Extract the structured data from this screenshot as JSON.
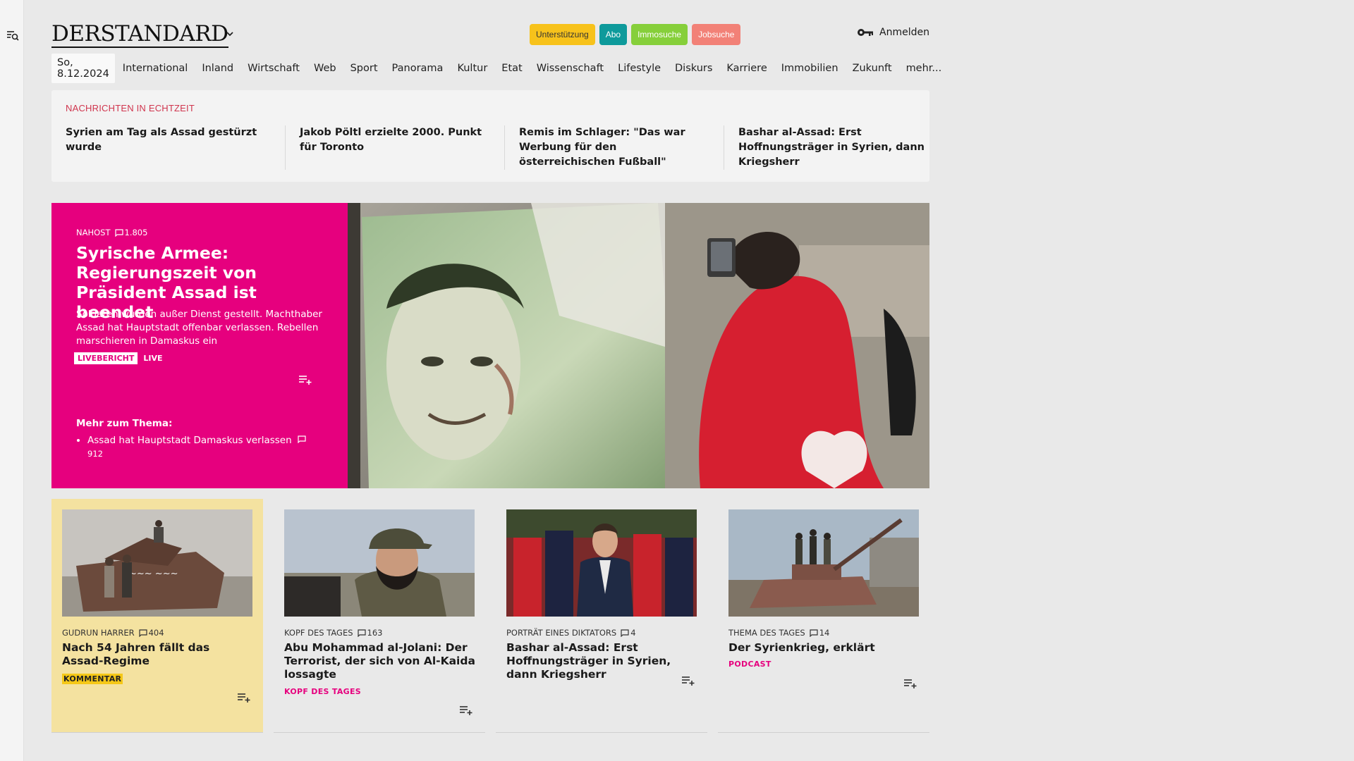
{
  "colors": {
    "accent_pink": "#e6007e",
    "ticker_red": "#d0354e",
    "card_yellow": "#f4e2a0"
  },
  "header": {
    "logo": "DERSTANDARD",
    "pills": [
      {
        "label": "Unterstützung",
        "bg": "#f7c21b",
        "fg": "#333333"
      },
      {
        "label": "Abo",
        "bg": "#0e9a9b",
        "fg": "#ffffff"
      },
      {
        "label": "Immosuche",
        "bg": "#86cf3a",
        "fg": "#ffffff"
      },
      {
        "label": "Jobsuche",
        "bg": "#f28177",
        "fg": "#ffffff"
      }
    ],
    "login_label": "Anmelden"
  },
  "nav": {
    "date": "So, 8.12.2024",
    "items": [
      "International",
      "Inland",
      "Wirtschaft",
      "Web",
      "Sport",
      "Panorama",
      "Kultur",
      "Etat",
      "Wissenschaft",
      "Lifestyle",
      "Diskurs",
      "Karriere",
      "Immobilien",
      "Zukunft",
      "mehr..."
    ]
  },
  "ticker": {
    "label": "NACHRICHTEN IN ECHTZEIT",
    "items": [
      "Syrien am Tag als Assad gestürzt wurde",
      "Jakob Pöltl erzielte 2000. Punkt für Toronto",
      "Remis im Schlager: \"Das war Wer­bung für den österreichischen Fußball\"",
      "Bashar al-Assad: Erst Hoffnungsträ­ger in Syrien, dann Kriegsherr"
    ]
  },
  "hero": {
    "kicker": "NAHOST",
    "comments": "1.805",
    "title": "Syrische Armee: Regierungszeit von Präsident Assad ist beendet",
    "lead": "Soldaten wurden außer Dienst gestellt. Machthaber Assad hat Hauptstadt offenbar verlassen. Rebellen marschieren in Damaskus ein",
    "tag_box": "LIVEBERICHT",
    "tag_live": "LIVE",
    "more_title": "Mehr zum Thema:",
    "more_items": [
      {
        "text": "Assad hat Hauptstadt Damaskus verlassen",
        "comments": "912"
      }
    ]
  },
  "cards": [
    {
      "kicker": "GUDRUN HARRER",
      "comments": "404",
      "title": "Nach 54 Jahren fällt das Assad-Regime",
      "tag": "KOMMENTAR"
    },
    {
      "kicker": "KOPF DES TAGES",
      "comments": "163",
      "title": "Abu Mohammad al-Jolani: Der Terrorist, der sich von Al-Kaida lossagte",
      "tag": "KOPF DES TAGES"
    },
    {
      "kicker": "PORTRÄT EINES DIKTATORS",
      "comments": "4",
      "title": "Bashar al-Assad: Erst Hoffnungs­träger in Syrien, dann Kriegsherr",
      "tag": ""
    },
    {
      "kicker": "THEMA DES TAGES",
      "comments": "14",
      "title": "Der Syrienkrieg, erklärt",
      "tag": "PODCAST"
    }
  ]
}
